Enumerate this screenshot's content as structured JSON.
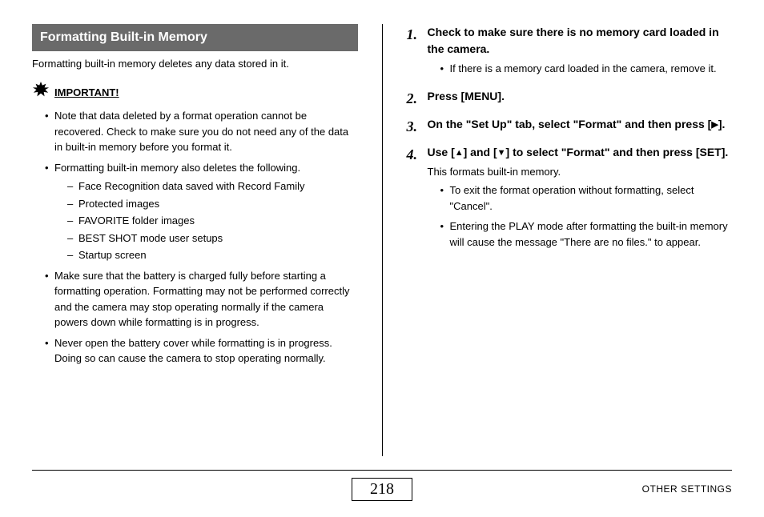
{
  "left": {
    "heading": "Formatting Built-in Memory",
    "intro": "Formatting built-in memory deletes any data stored in it.",
    "important_label": "IMPORTANT!",
    "bullets": [
      "Note that data deleted by a format operation cannot be recovered. Check to make sure you do not need any of the data in built-in memory before you format it.",
      "Formatting built-in memory also deletes the following.",
      "Make sure that the battery is charged fully before starting a formatting operation. Formatting may not be performed correctly and the camera may stop operating normally if the camera powers down while formatting is in progress.",
      "Never open the battery cover while formatting is in progress. Doing so can cause the camera to stop operating normally."
    ],
    "sub_dashes": [
      "Face Recognition data saved with Record Family",
      "Protected images",
      "FAVORITE folder images",
      "BEST SHOT mode user setups",
      "Startup screen"
    ]
  },
  "right": {
    "steps": [
      {
        "title": "Check to make sure there is no memory card loaded in the camera.",
        "s_bullets": [
          "If there is a memory card loaded in the camera, remove it."
        ]
      },
      {
        "title": "Press [MENU]."
      },
      {
        "title_pre": "On the \"Set Up\" tab, select \"Format\" and then press [",
        "title_post": "]."
      },
      {
        "title_pre": "Use [",
        "title_mid": "] and [",
        "title_post": "] to select \"Format\" and then press [SET].",
        "body": "This formats built-in memory.",
        "s_bullets": [
          "To exit the format operation without formatting, select \"Cancel\".",
          "Entering the PLAY mode after formatting the built-in memory will cause the message \"There are no files.\" to appear."
        ]
      }
    ]
  },
  "footer": {
    "page_number": "218",
    "section": "OTHER SETTINGS"
  }
}
